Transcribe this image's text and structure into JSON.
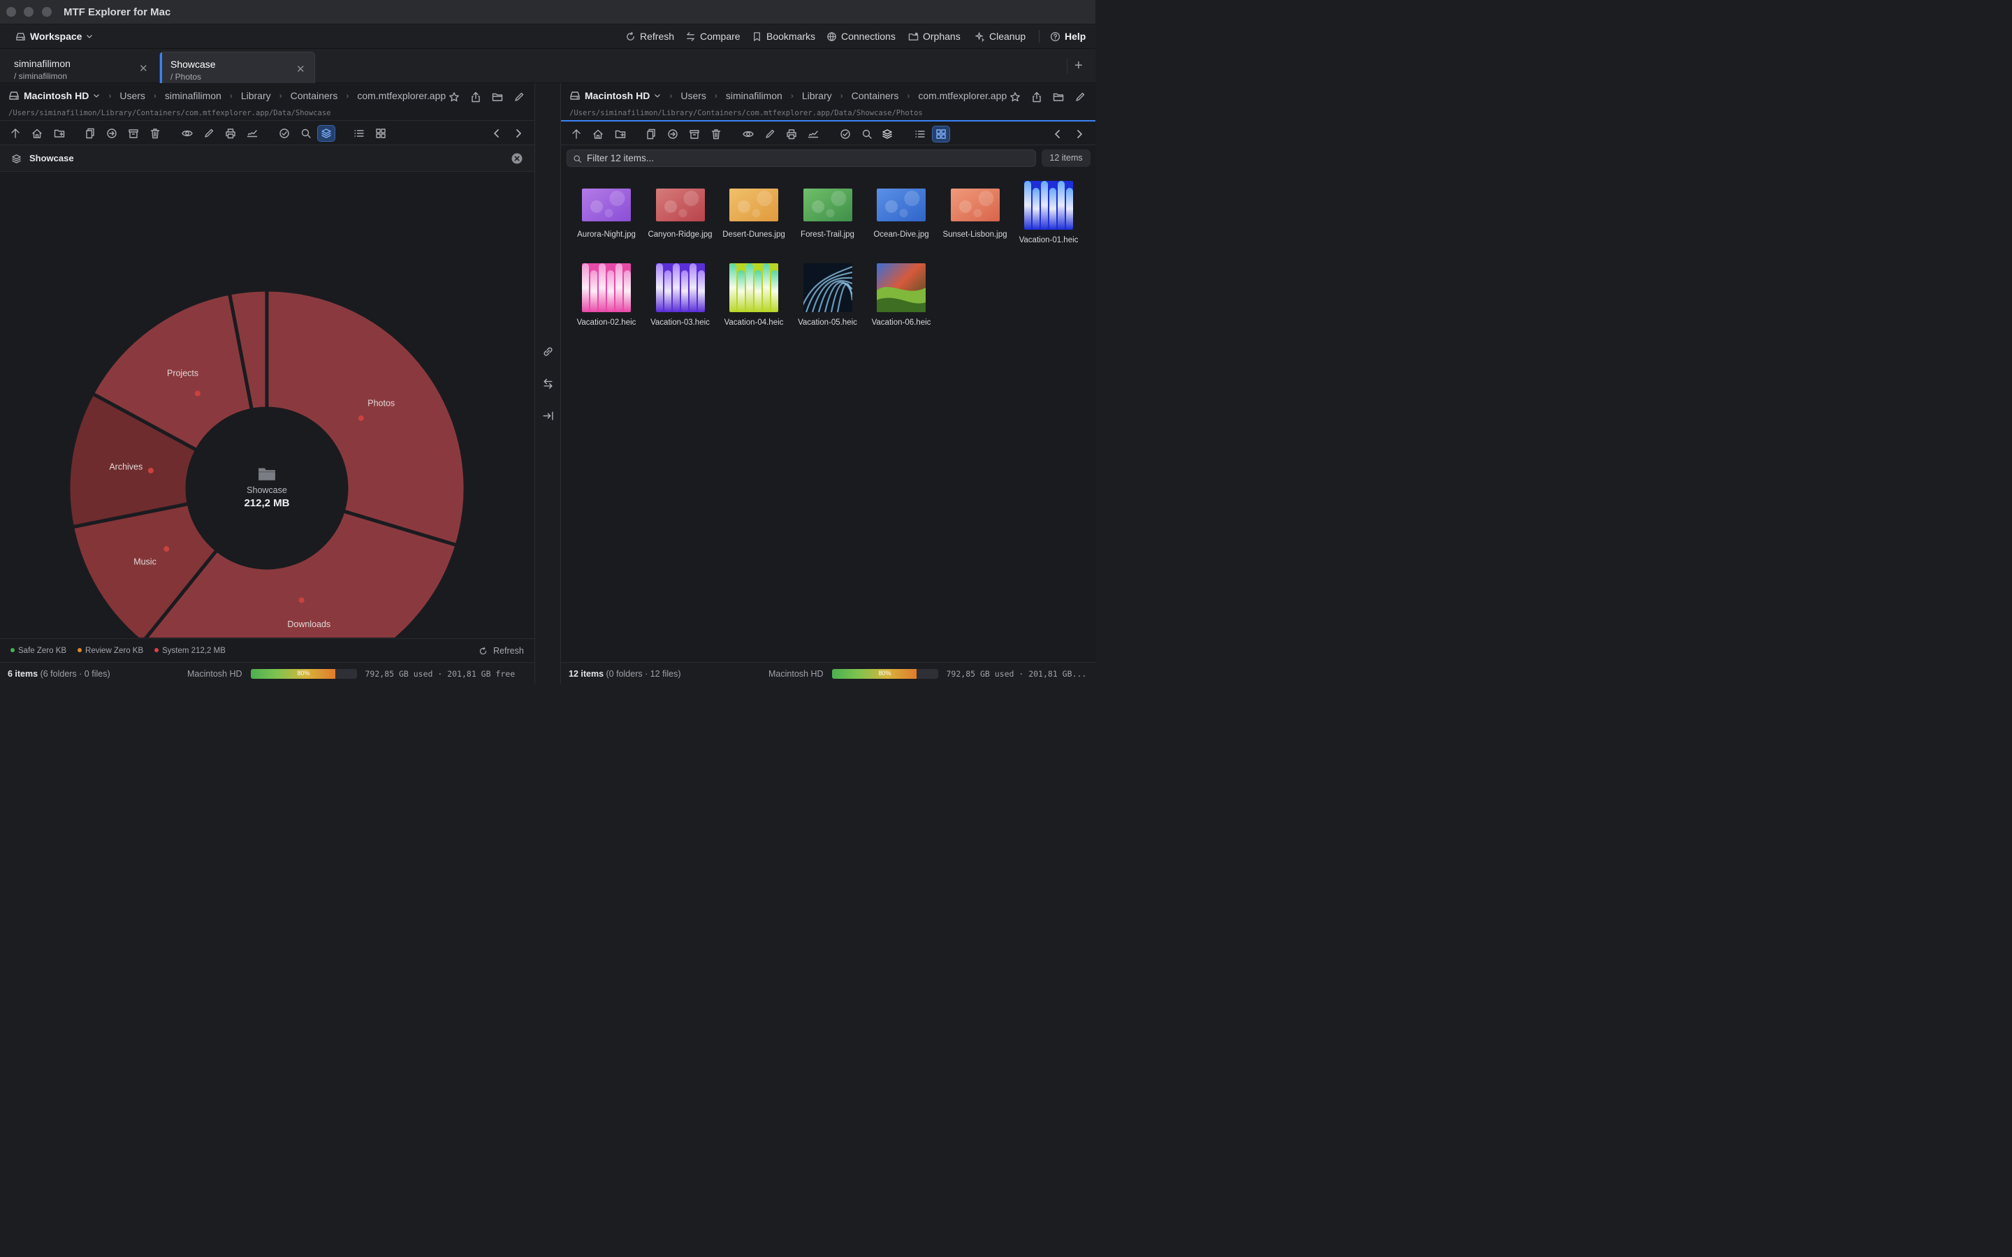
{
  "app": {
    "title": "MTF Explorer for Mac"
  },
  "menubar": {
    "workspace": "Workspace",
    "actions": [
      {
        "id": "refresh",
        "label": "Refresh",
        "icon": "refresh-icon"
      },
      {
        "id": "compare",
        "label": "Compare",
        "icon": "compare-icon"
      },
      {
        "id": "bookmarks",
        "label": "Bookmarks",
        "icon": "bookmark-icon"
      },
      {
        "id": "connections",
        "label": "Connections",
        "icon": "globe-icon"
      },
      {
        "id": "orphans",
        "label": "Orphans",
        "icon": "folder-warning-icon"
      },
      {
        "id": "cleanup",
        "label": "Cleanup",
        "icon": "sparkle-icon"
      }
    ],
    "help": "Help"
  },
  "tabs": [
    {
      "title": "siminafilimon",
      "subtitle": "/ siminafilimon",
      "active": false
    },
    {
      "title": "Showcase",
      "subtitle": "/ Photos",
      "active": true
    }
  ],
  "left": {
    "volume": "Macintosh HD",
    "crumbs": [
      "Users",
      "siminafilimon",
      "Library",
      "Containers",
      "com.mtfexplorer.app"
    ],
    "path": "/Users/siminafilimon/Library/Containers/com.mtfexplorer.app/Data/Showcase",
    "panel_title": "Showcase",
    "center": {
      "label": "Showcase",
      "size": "212,2 MB"
    },
    "legend": [
      {
        "label": "Safe Zero KB",
        "color": "#4caf50"
      },
      {
        "label": "Review Zero KB",
        "color": "#d88a2a"
      },
      {
        "label": "System 212,2 MB",
        "color": "#d9423f"
      }
    ],
    "refresh": "Refresh",
    "status": {
      "count": "6 items",
      "detail": "(6 folders · 0 files)",
      "disk": "Macintosh HD",
      "usage_pct": 80,
      "usage_label": "80%",
      "space": "792,85 GB used · 201,81 GB free"
    }
  },
  "right": {
    "volume": "Macintosh HD",
    "crumbs": [
      "Users",
      "siminafilimon",
      "Library",
      "Containers",
      "com.mtfexplorer.app"
    ],
    "path": "/Users/siminafilimon/Library/Containers/com.mtfexplorer.app/Data/Showcase/Photos",
    "filter_placeholder": "Filter 12 items...",
    "count_badge": "12 items",
    "files": [
      {
        "name": "Aurora-Night.jpg",
        "kind": "aurora"
      },
      {
        "name": "Canyon-Ridge.jpg",
        "kind": "canyon"
      },
      {
        "name": "Desert-Dunes.jpg",
        "kind": "desert"
      },
      {
        "name": "Forest-Trail.jpg",
        "kind": "forest"
      },
      {
        "name": "Ocean-Dive.jpg",
        "kind": "ocean"
      },
      {
        "name": "Sunset-Lisbon.jpg",
        "kind": "sunset"
      },
      {
        "name": "Vacation-01.heic",
        "kind": "v1"
      },
      {
        "name": "Vacation-02.heic",
        "kind": "v2"
      },
      {
        "name": "Vacation-03.heic",
        "kind": "v3"
      },
      {
        "name": "Vacation-04.heic",
        "kind": "v4"
      },
      {
        "name": "Vacation-05.heic",
        "kind": "v5"
      },
      {
        "name": "Vacation-06.heic",
        "kind": "v6"
      }
    ],
    "status": {
      "count": "12 items",
      "detail": "(0 folders · 12 files)",
      "disk": "Macintosh HD",
      "usage_pct": 80,
      "usage_label": "80%",
      "space": "792,85 GB used · 201,81 GB..."
    }
  },
  "chart_data": {
    "type": "pie",
    "title": "Showcase",
    "total": "212,2 MB",
    "categories": [
      "Photos",
      "Downloads",
      "Music",
      "Archives",
      "Projects",
      "(unlabeled)"
    ],
    "values": [
      29.5,
      31.0,
      11.0,
      11.0,
      14.0,
      3.0
    ],
    "unit": "% of total (estimated)"
  }
}
